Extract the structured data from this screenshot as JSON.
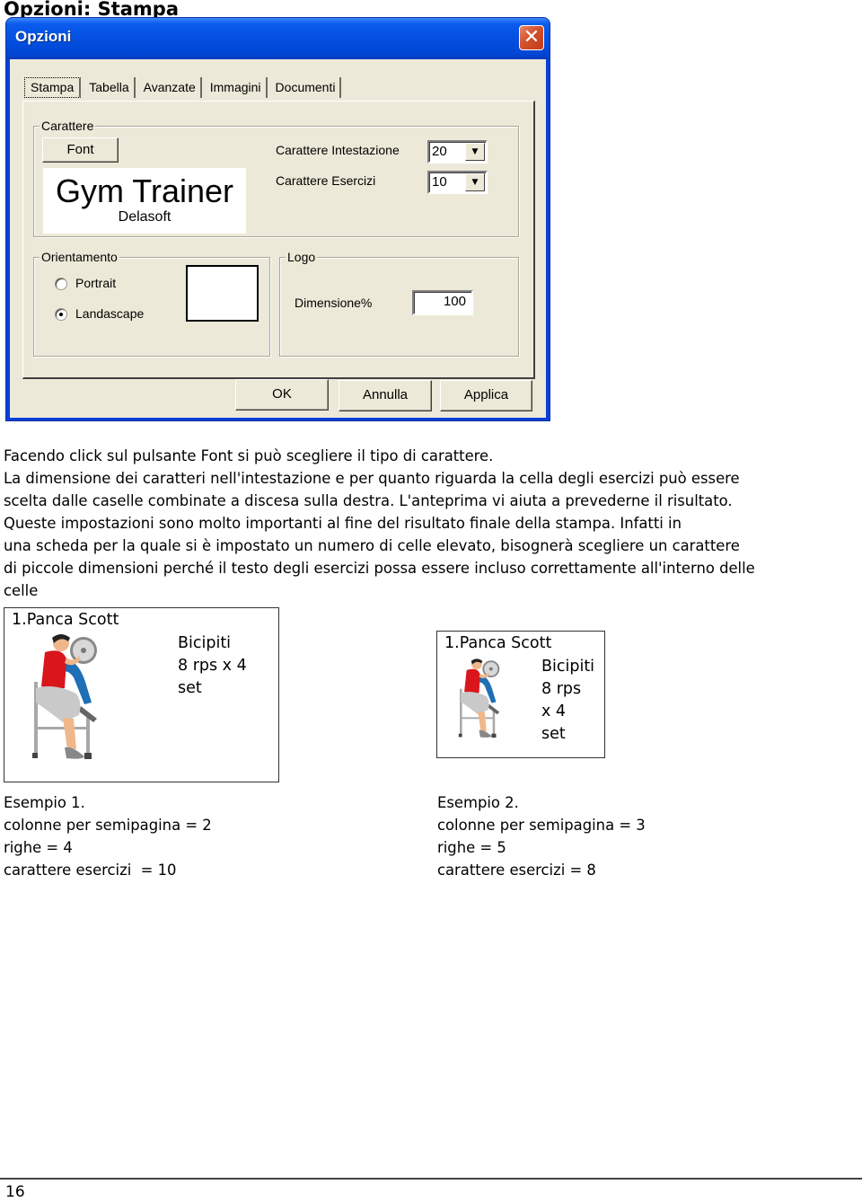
{
  "page": {
    "heading": "Opzioni: Stampa",
    "page_number": "16"
  },
  "dialog": {
    "title": "Opzioni",
    "close_icon": "close-icon",
    "tabs": [
      {
        "label": "Stampa",
        "active": true
      },
      {
        "label": "Tabella",
        "active": false
      },
      {
        "label": "Avanzate",
        "active": false
      },
      {
        "label": "Immagini",
        "active": false
      },
      {
        "label": "Documenti",
        "active": false
      }
    ],
    "carattere": {
      "legend": "Carattere",
      "font_button": "Font",
      "preview_title": "Gym Trainer",
      "preview_subtitle": "Delasoft",
      "intestazione_label": "Carattere Intestazione",
      "intestazione_value": "20",
      "esercizi_label": "Carattere Esercizi",
      "esercizi_value": "10"
    },
    "orientamento": {
      "legend": "Orientamento",
      "options": [
        {
          "label": "Portrait",
          "selected": false
        },
        {
          "label": "Landascape",
          "selected": true
        }
      ]
    },
    "logo": {
      "legend": "Logo",
      "dimensione_label": "Dimensione%",
      "dimensione_value": "100"
    },
    "buttons": {
      "ok": "OK",
      "cancel": "Annulla",
      "apply": "Applica"
    }
  },
  "body": {
    "lines": [
      "Facendo click sul pulsante Font si può scegliere il tipo di carattere.",
      "La dimensione dei caratteri nell'intestazione e per quanto riguarda la cella degli esercizi può essere",
      "scelta dalle caselle combinate a discesa sulla destra. L'anteprima vi aiuta a prevederne il risultato.",
      "Queste impostazioni sono molto importanti al fine del risultato finale della stampa. Infatti in",
      "una scheda per la quale si è impostato un numero di celle elevato, bisognerà scegliere un carattere",
      "di piccole dimensioni perché il testo degli esercizi possa essere incluso correttamente all'interno delle",
      "celle"
    ]
  },
  "examples": [
    {
      "card": {
        "exercise": "1.Panca Scott",
        "detail_lines": [
          "Bicipiti",
          "8 rps x 4",
          "set"
        ],
        "image": "preacher-curl-figure"
      },
      "caption_lines": [
        "Esempio 1.",
        "colonne per semipagina = 2",
        "righe = 4",
        "carattere esercizi  = 10"
      ]
    },
    {
      "card": {
        "exercise": "1.Panca Scott",
        "detail_lines": [
          "Bicipiti",
          "8 rps",
          "x 4",
          "set"
        ],
        "image": "preacher-curl-figure"
      },
      "caption_lines": [
        "Esempio 2.",
        "colonne per semipagina = 3",
        "righe = 5",
        "carattere esercizi = 8"
      ]
    }
  ]
}
